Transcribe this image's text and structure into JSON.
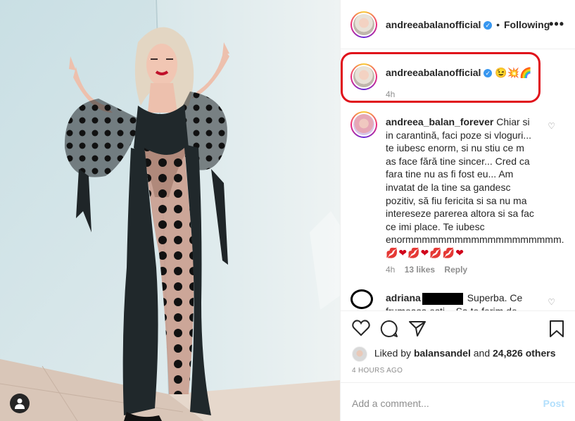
{
  "post": {
    "username": "andreeabalanofficial",
    "follow_sep": "•",
    "follow_status": "Following",
    "more_label": "•••",
    "caption_emojis": "😉💥🌈",
    "caption_time": "4h"
  },
  "comments": [
    {
      "username": "andreea_balan_forever",
      "text": "Chiar si in carantină, faci poze si vloguri... te iubesc enorm, si nu stiu ce m as face fără tine sincer... Cred ca fara tine nu as fi fost eu... Am invatat de la tine sa gandesc pozitiv, să fiu fericita si sa nu ma intereseze parerea altora si sa fac ce imi place. Te iubesc enormmmmmmmmmmmmmmmmmmm.",
      "hearts": "💋❤💋❤💋💋❤",
      "time": "4h",
      "likes": "13 likes",
      "reply": "Reply"
    },
    {
      "username_prefix": "adriana",
      "text": "Superba. Ce",
      "text_cut": "frumoasa esti... Sa te ferim de"
    }
  ],
  "likes_line": {
    "prefix": "Liked by",
    "user": "balansandel",
    "and": "and",
    "count": "24,826 others"
  },
  "posted_ago": "4 HOURS AGO",
  "add_comment": {
    "placeholder": "Add a comment...",
    "post_label": "Post"
  },
  "colors": {
    "highlight": "#e0121b",
    "verified": "#3897f0",
    "post_disabled": "#b2dffc"
  },
  "icons": {
    "like": "heart-icon",
    "comment": "comment-icon",
    "share": "paper-plane-icon",
    "save": "bookmark-icon",
    "user_tag": "user-icon"
  }
}
